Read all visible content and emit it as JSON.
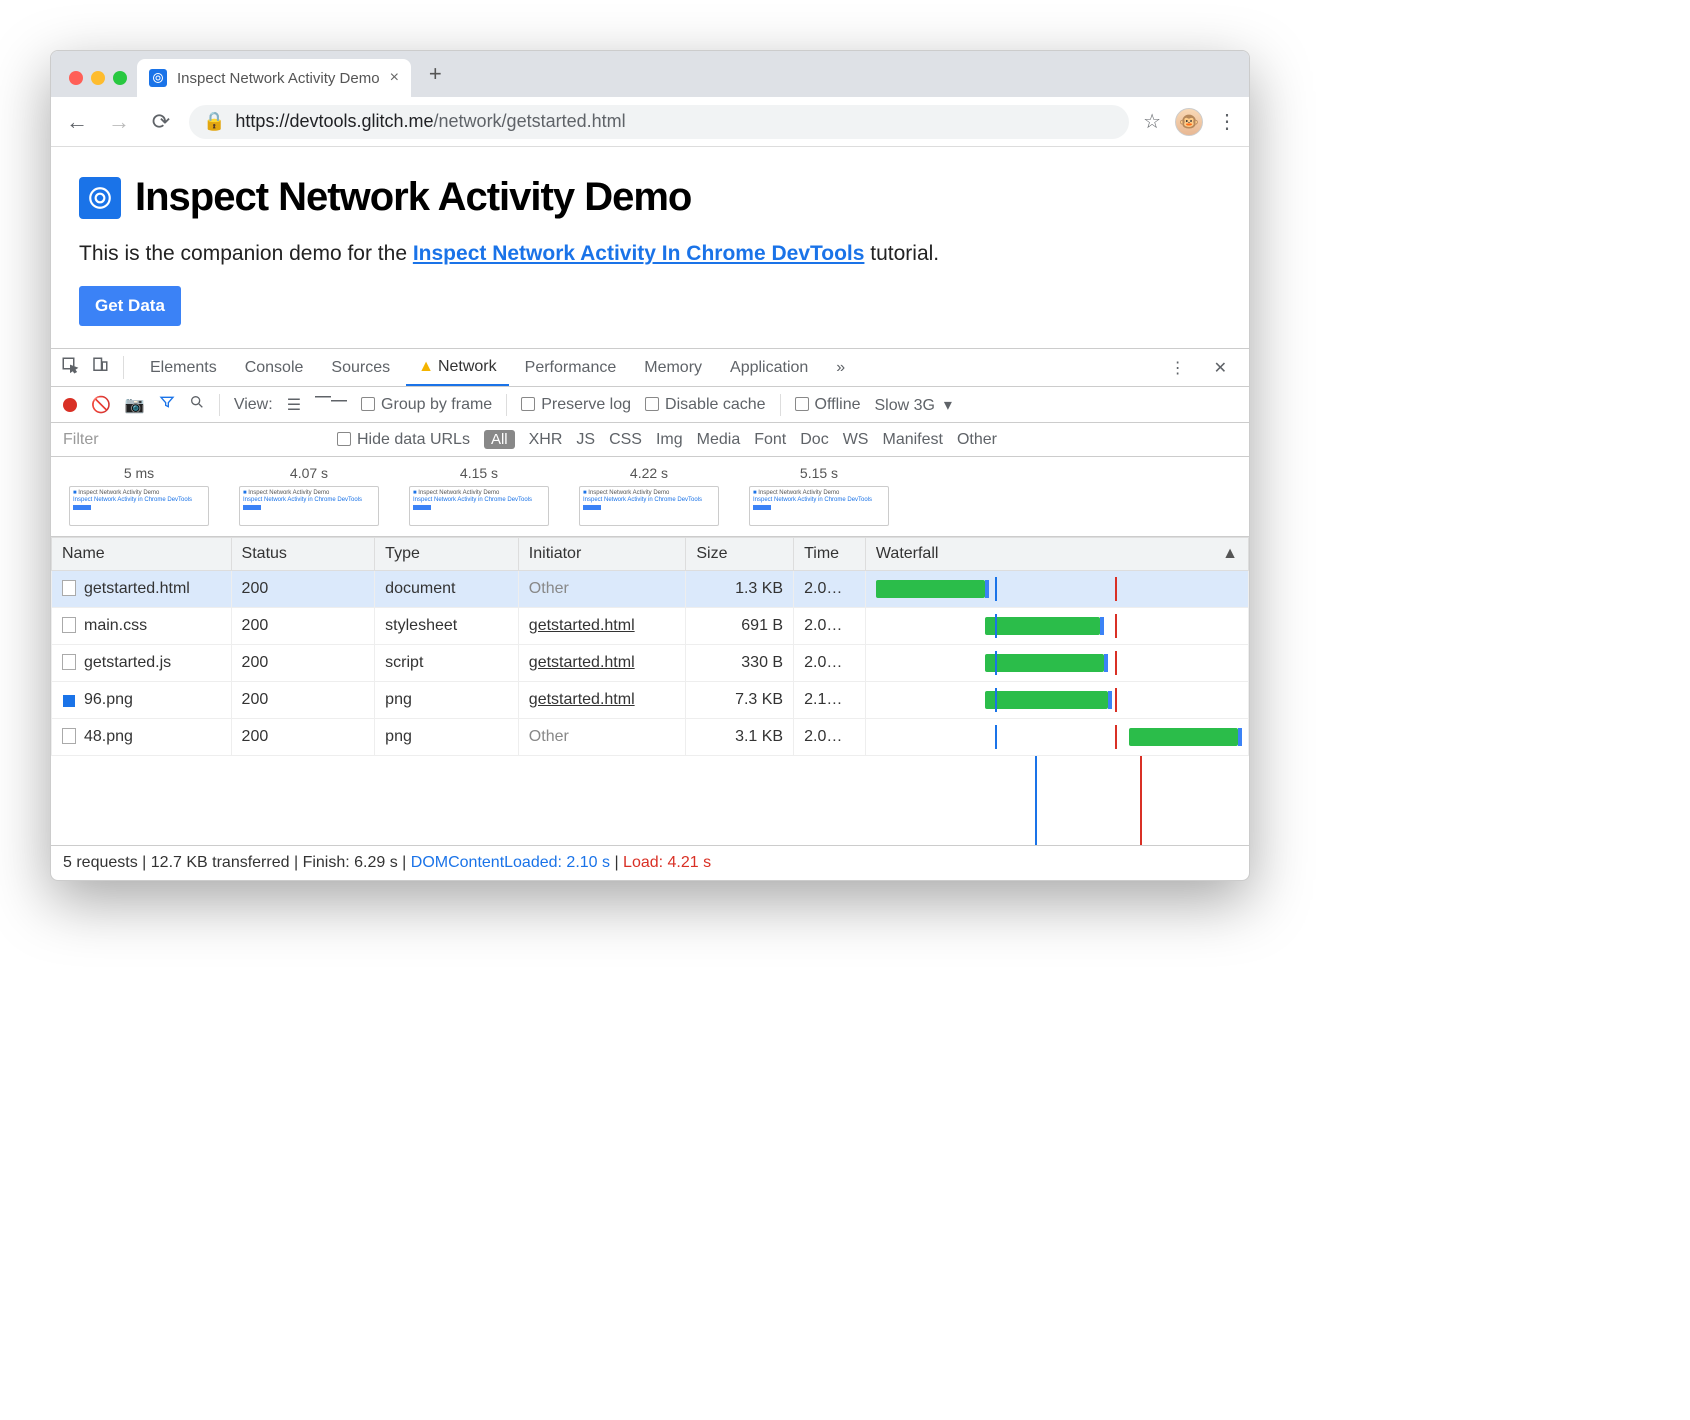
{
  "browser": {
    "tab_title": "Inspect Network Activity Demo",
    "url_host": "https://devtools.glitch.me",
    "url_path": "/network/getstarted.html"
  },
  "page": {
    "heading": "Inspect Network Activity Demo",
    "intro_pre": "This is the companion demo for the ",
    "intro_link": "Inspect Network Activity In Chrome DevTools",
    "intro_post": " tutorial.",
    "button": "Get Data"
  },
  "devtools": {
    "tabs": [
      "Elements",
      "Console",
      "Sources",
      "Network",
      "Performance",
      "Memory",
      "Application"
    ],
    "active_tab": "Network",
    "toolbar": {
      "view_label": "View:",
      "group_by_frame": "Group by frame",
      "preserve_log": "Preserve log",
      "disable_cache": "Disable cache",
      "offline": "Offline",
      "throttle": "Slow 3G"
    },
    "filter": {
      "placeholder": "Filter",
      "hide_data_urls": "Hide data URLs",
      "types": [
        "All",
        "XHR",
        "JS",
        "CSS",
        "Img",
        "Media",
        "Font",
        "Doc",
        "WS",
        "Manifest",
        "Other"
      ],
      "active_type": "All"
    },
    "filmstrip": [
      "5 ms",
      "4.07 s",
      "4.15 s",
      "4.22 s",
      "5.15 s"
    ],
    "columns": [
      "Name",
      "Status",
      "Type",
      "Initiator",
      "Size",
      "Time",
      "Waterfall"
    ],
    "rows": [
      {
        "name": "getstarted.html",
        "status": "200",
        "type": "document",
        "initiator": "Other",
        "initiator_link": false,
        "size": "1.3 KB",
        "time": "2.0…",
        "icon": "doc",
        "selected": true,
        "wf_start": 0,
        "wf_width": 30,
        "cap": 30
      },
      {
        "name": "main.css",
        "status": "200",
        "type": "stylesheet",
        "initiator": "getstarted.html",
        "initiator_link": true,
        "size": "691 B",
        "time": "2.0…",
        "icon": "doc",
        "wf_start": 30,
        "wf_width": 32,
        "cap": 62
      },
      {
        "name": "getstarted.js",
        "status": "200",
        "type": "script",
        "initiator": "getstarted.html",
        "initiator_link": true,
        "size": "330 B",
        "time": "2.0…",
        "icon": "doc",
        "wf_start": 30,
        "wf_width": 33,
        "cap": 63
      },
      {
        "name": "96.png",
        "status": "200",
        "type": "png",
        "initiator": "getstarted.html",
        "initiator_link": true,
        "size": "7.3 KB",
        "time": "2.1…",
        "icon": "img",
        "wf_start": 30,
        "wf_width": 34,
        "cap": 64
      },
      {
        "name": "48.png",
        "status": "200",
        "type": "png",
        "initiator": "Other",
        "initiator_link": false,
        "size": "3.1 KB",
        "time": "2.0…",
        "icon": "empty",
        "wf_start": 70,
        "wf_width": 30,
        "cap": 100
      }
    ],
    "status": {
      "requests": "5 requests",
      "transferred": "12.7 KB transferred",
      "finish": "Finish: 6.29 s",
      "dcl": "DOMContentLoaded: 2.10 s",
      "load": "Load: 4.21 s"
    }
  }
}
